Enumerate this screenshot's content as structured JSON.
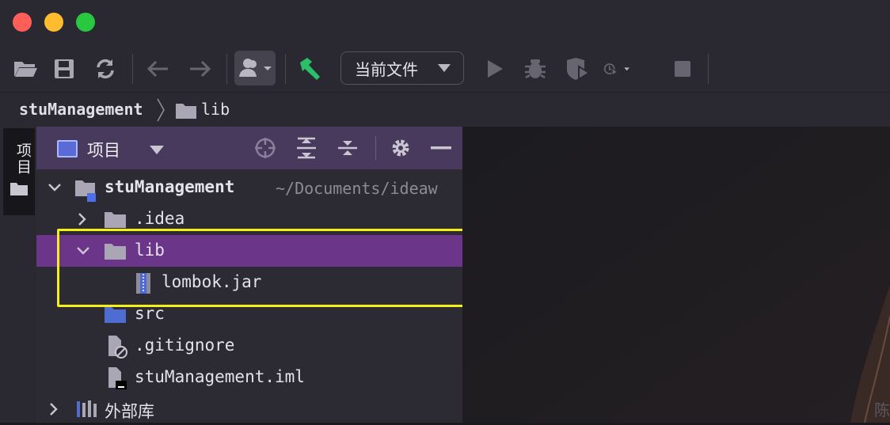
{
  "toolbar": {
    "run_config": "当前文件",
    "icons": [
      "open-folder-icon",
      "save-icon",
      "sync-icon",
      "back-icon",
      "forward-icon",
      "user-icon",
      "build-hammer-icon",
      "run-icon",
      "debug-icon",
      "coverage-icon",
      "profile-icon",
      "stop-icon"
    ]
  },
  "breadcrumb": {
    "root": "stuManagement",
    "child": "lib"
  },
  "side": {
    "project_tab": "项目"
  },
  "panel": {
    "title": "项目"
  },
  "tree": {
    "root_name": "stuManagement",
    "root_path": "~/Documents/ideaw",
    "idea": ".idea",
    "lib": "lib",
    "jar": "lombok.jar",
    "src": "src",
    "gitignore": ".gitignore",
    "iml": "stuManagement.iml",
    "external": "外部库"
  },
  "editor": {
    "partial_text": "陈"
  },
  "colors": {
    "selection": "#6b3589",
    "highlight_box": "#f4f015",
    "panel_header": "#483a5c",
    "build_green": "#2bbf6a"
  }
}
